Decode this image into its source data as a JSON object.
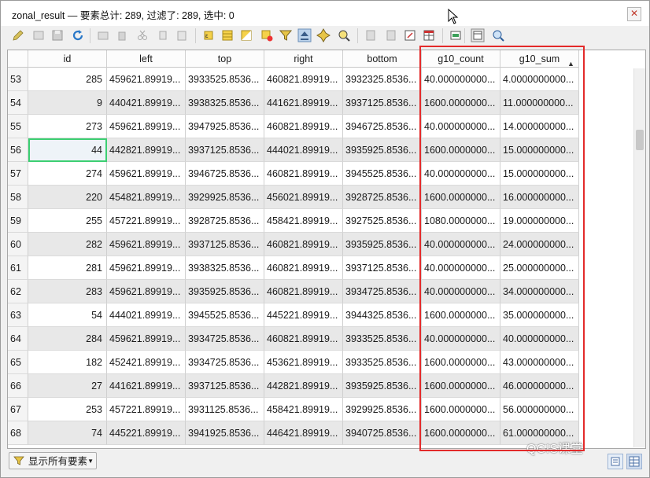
{
  "window": {
    "title": "zonal_result — 要素总计: 289, 过滤了: 289, 选中: 0",
    "close_symbol": "✕"
  },
  "toolbar": {
    "icons": [
      "pencil-icon",
      "multi-edit-icon",
      "save-icon",
      "reload-icon",
      "add-feature-icon",
      "delete-icon",
      "cut-icon",
      "copy-icon",
      "paste-icon",
      "expression-select-icon",
      "select-all-icon",
      "invert-selection-icon",
      "deselect-icon",
      "filter-icon",
      "move-to-top-icon",
      "pan-to-selection-icon",
      "zoom-to-selection-icon",
      "new-field-icon",
      "delete-field-icon",
      "field-calculator-icon",
      "conditional-format-icon",
      "actions-icon",
      "dock-icon",
      "zoom-map-icon"
    ]
  },
  "table": {
    "columns": [
      "id",
      "left",
      "top",
      "right",
      "bottom",
      "g10_count",
      "g10_sum"
    ],
    "sort_column": "g10_sum",
    "sort_indicator": "▲",
    "rows": [
      {
        "row": "53",
        "id": "285",
        "left": "459621.89919...",
        "top": "3933525.8536...",
        "right": "460821.89919...",
        "bottom": "3932325.8536...",
        "g10_count": "40.000000000...",
        "g10_sum": "4.0000000000..."
      },
      {
        "row": "54",
        "id": "9",
        "left": "440421.89919...",
        "top": "3938325.8536...",
        "right": "441621.89919...",
        "bottom": "3937125.8536...",
        "g10_count": "1600.0000000...",
        "g10_sum": "11.000000000..."
      },
      {
        "row": "55",
        "id": "273",
        "left": "459621.89919...",
        "top": "3947925.8536...",
        "right": "460821.89919...",
        "bottom": "3946725.8536...",
        "g10_count": "40.000000000...",
        "g10_sum": "14.000000000..."
      },
      {
        "row": "56",
        "id": "44",
        "left": "442821.89919...",
        "top": "3937125.8536...",
        "right": "444021.89919...",
        "bottom": "3935925.8536...",
        "g10_count": "1600.0000000...",
        "g10_sum": "15.000000000..."
      },
      {
        "row": "57",
        "id": "274",
        "left": "459621.89919...",
        "top": "3946725.8536...",
        "right": "460821.89919...",
        "bottom": "3945525.8536...",
        "g10_count": "40.000000000...",
        "g10_sum": "15.000000000..."
      },
      {
        "row": "58",
        "id": "220",
        "left": "454821.89919...",
        "top": "3929925.8536...",
        "right": "456021.89919...",
        "bottom": "3928725.8536...",
        "g10_count": "1600.0000000...",
        "g10_sum": "16.000000000..."
      },
      {
        "row": "59",
        "id": "255",
        "left": "457221.89919...",
        "top": "3928725.8536...",
        "right": "458421.89919...",
        "bottom": "3927525.8536...",
        "g10_count": "1080.0000000...",
        "g10_sum": "19.000000000..."
      },
      {
        "row": "60",
        "id": "282",
        "left": "459621.89919...",
        "top": "3937125.8536...",
        "right": "460821.89919...",
        "bottom": "3935925.8536...",
        "g10_count": "40.000000000...",
        "g10_sum": "24.000000000..."
      },
      {
        "row": "61",
        "id": "281",
        "left": "459621.89919...",
        "top": "3938325.8536...",
        "right": "460821.89919...",
        "bottom": "3937125.8536...",
        "g10_count": "40.000000000...",
        "g10_sum": "25.000000000..."
      },
      {
        "row": "62",
        "id": "283",
        "left": "459621.89919...",
        "top": "3935925.8536...",
        "right": "460821.89919...",
        "bottom": "3934725.8536...",
        "g10_count": "40.000000000...",
        "g10_sum": "34.000000000..."
      },
      {
        "row": "63",
        "id": "54",
        "left": "444021.89919...",
        "top": "3945525.8536...",
        "right": "445221.89919...",
        "bottom": "3944325.8536...",
        "g10_count": "1600.0000000...",
        "g10_sum": "35.000000000..."
      },
      {
        "row": "64",
        "id": "284",
        "left": "459621.89919...",
        "top": "3934725.8536...",
        "right": "460821.89919...",
        "bottom": "3933525.8536...",
        "g10_count": "40.000000000...",
        "g10_sum": "40.000000000..."
      },
      {
        "row": "65",
        "id": "182",
        "left": "452421.89919...",
        "top": "3934725.8536...",
        "right": "453621.89919...",
        "bottom": "3933525.8536...",
        "g10_count": "1600.0000000...",
        "g10_sum": "43.000000000..."
      },
      {
        "row": "66",
        "id": "27",
        "left": "441621.89919...",
        "top": "3937125.8536...",
        "right": "442821.89919...",
        "bottom": "3935925.8536...",
        "g10_count": "1600.0000000...",
        "g10_sum": "46.000000000..."
      },
      {
        "row": "67",
        "id": "253",
        "left": "457221.89919...",
        "top": "3931125.8536...",
        "right": "458421.89919...",
        "bottom": "3929925.8536...",
        "g10_count": "1600.0000000...",
        "g10_sum": "56.000000000..."
      },
      {
        "row": "68",
        "id": "74",
        "left": "445221.89919...",
        "top": "3941925.8536...",
        "right": "446421.89919...",
        "bottom": "3940725.8536...",
        "g10_count": "1600.0000000...",
        "g10_sum": "61.000000000..."
      }
    ],
    "selected_cell": {
      "row_index": 3,
      "column": "id"
    }
  },
  "bottom": {
    "filter_label": "显示所有要素",
    "watermark": "QGIS课堂"
  },
  "colors": {
    "highlight_border": "#e32a2a",
    "selected_cell_border": "#3ccf72",
    "alt_row": "#e8e8e8"
  }
}
